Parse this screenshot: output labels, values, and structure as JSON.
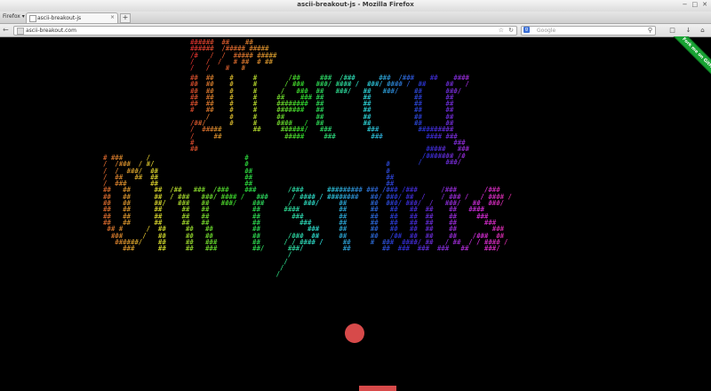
{
  "window": {
    "title": "ascii-breakout-js - Mozilla Firefox"
  },
  "menu": {
    "label": "Firefox"
  },
  "tab": {
    "title": "ascii-breakout-js"
  },
  "url": {
    "value": "ascii-breakout.com"
  },
  "search": {
    "placeholder": "Google"
  },
  "ribbon": {
    "text": "Fork me on GitHub"
  },
  "colors": {
    "ball": "#d74a4a",
    "paddle": "#d74a4a",
    "background": "#000000",
    "ribbon": "#18a333"
  },
  "art": {
    "ascii_lines": [
      "######  ##    ##",
      "######  /##### #####",
      "/#   /  /  ##### #####",
      "/   /  /   # ##  # ##",
      "/   /    #   #"
    ],
    "breakout_top": [
      "##  ##    #     #        /##     ###  /###      ###  /###    ##    ####",
      "##  ##    #     #       / ###   ###/ #### /  ###/ #### /  ##     ##   /",
      "##  ##    #     #      /   ###  ##   ###/   ##   ###/    ##      ###/",
      "##  ##    #     #     ##    ### ##          ##           ##      ##",
      "##  ##    #     #     ########  ##          ##           ##      ##",
      "#   ##    #     #     #######   ##          ##           ##      ##",
      "    /     #     #     ##        ##          ##           ##      ##",
      "/##/      #     #     ####   /  ##          ##           ##      ##",
      "/  #####        ##     ######/   ###         ###          #########",
      "/     ##                #####     ###         ###           #### ###",
      "#                                                                  ###",
      "##                                                          #####   ###",
      "                                                           /####### /#",
      "                                                          /      ###/"
    ],
    "breakout_bottom": [
      "# ###      /                        #",
      "/  /###  / #/                       #                                   #",
      "/  /  ###/  ##                      ##                                  #",
      "/  ##   ##  ##                      ##                                  ##",
      "/  ###      ##                      ##                                  ##",
      "##   ##      ##  /##   ###  /###    ###        /###      ######### ### /### /###      /###       /###",
      "##   ##      ##  / ###   ###/ #### /   ###      / #### / ########   ##/ ###/ ##  /    / ### /   / #### /",
      "##   ##      ##/   ###   ##   ###/    ###      /   ###/     ##      ##  ###/ ###/  /   ###/   ##  ###/",
      "##   ##      ##     ##   ##           ##      ####          ##      ##   ##   ##  ##    ##   ####",
      "##   ##      ##     ##   ##           ##        ###         ##      ##   ##   ##  ##    ##     ###",
      "##   ##      ##     ##   ##           ##          ###       ##      ##   ##   ##  ##    ##       ###",
      " ## #      /  ##     ##   ##          ##            ###     ##      ##   ##   ##  ##    ##         ###",
      "  ###     /   ##     ##   ##          ##       /###  ##     ##      ##   /##  ##  ##    ##    /###  ##",
      "   ######/    ##     ##   ###         ##      / / #### /     ##     #  ###  ####/ ##   / ##  / / #### /",
      "     ###      ##     ##   ###         ##/      ###/          ##        ##  ###  ###  ###   ##    ###/",
      "                                               /",
      "                                              /",
      "                                             /",
      "                                            /"
    ]
  }
}
